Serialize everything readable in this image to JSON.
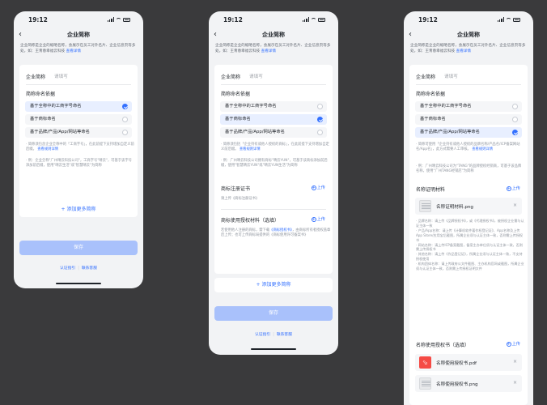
{
  "common": {
    "time": "19:12",
    "title": "企业简称",
    "intro": "企业简称是企业的缩略名称，会展示在员工对外名片、企业信息页等多处。如：王青春幸福云科技",
    "intro_link": "查看详情",
    "name_label": "企业简称",
    "name_placeholder": "请填写",
    "basis_label": "简称命名依据",
    "options": [
      "基于全称中的工商字号命名",
      "基于商标命名",
      "基于品牌/产品/App/网站等命名"
    ],
    "add_more": "添加更多简称",
    "save": "保存",
    "help_link": "认证指引",
    "separator": "|",
    "contact_link": "联系客服",
    "upload": "上传",
    "add_icon": "+",
    "close_icon": "×"
  },
  "screen1": {
    "selected_option": 0,
    "note": "简称须包含企业全称中的「工商字号」，在此前提下支持增加自定义前后缀。",
    "note_link": "查看规则详情",
    "example": "例：企业全称\"广州晴云科技公司\"，工商字号\"晴云\"，可基于该字号添加前后缀，使用\"晴云生活\"或\"智慧晴云\"为简称"
  },
  "screen2": {
    "selected_option": 1,
    "note": "简称须包括「企业持有或他人授权的商标」，在此前提下支持增加自定义前后缀。",
    "note_link": "查看规则详情",
    "example": "例：广州晴云科技公司拥有商标\"晴云YUN\"，可基于该商标添加前后缀，使用\"智慧晴云YUN\"或\"晴云YUN生活\"为简称",
    "cert_label": "商标注册证书",
    "cert_hint": "请上传《商标注册证书》",
    "auth_label": "商标使用授权材料（选填）",
    "auth_hint": "若使用他人注册的商标，需下载",
    "auth_link": "《商标授权书》",
    "auth_hint2": "，由商标所有者授权盖章后上传；也可上传商标局提供的《商标使用许可备案书》"
  },
  "screen3": {
    "selected_option": 2,
    "note": "简称可使用「企业持有或他人授权的品牌名称/产品名/ICP备案网站名/App名」，此方式需要人工审核。",
    "note_link": "查看规则详情",
    "example": "例：广州晴云科技公司为\"TANG\"的品牌授权经销商，可基于该品牌名称，使用\"广州TANG经销店\"为简称",
    "proof_label": "名称证明材料",
    "proof_file": "名称证明材料.png",
    "bullets": [
      "品牌名称：请上传《品牌授权书》，或《代理授权书》，被授权企业需与认证主体一致",
      "产品/App名称：请上传《计算机软件著作权登记证》、App名称及上传App Store/应用宝后截图，所属企业须与认证主体一致，否则需上传授权书",
      "网站名称：请上传ICP备案截图，备案主办单位须与认证主体一致，否则需上传授权书",
      "其他名称：请上传《作品登记证》，所属企业须与认证主体一致，不支持授权使用",
      "机构团体名称：请上传政府公文件截图、主办机构官网或截图，所属企业须与认证主体一致，否则需上传授权证明文件"
    ],
    "auth_label": "名称使用授权书（选填）",
    "auth_file1": "名称使用授权书.pdf",
    "auth_file2": "名称使用授权书.png"
  }
}
